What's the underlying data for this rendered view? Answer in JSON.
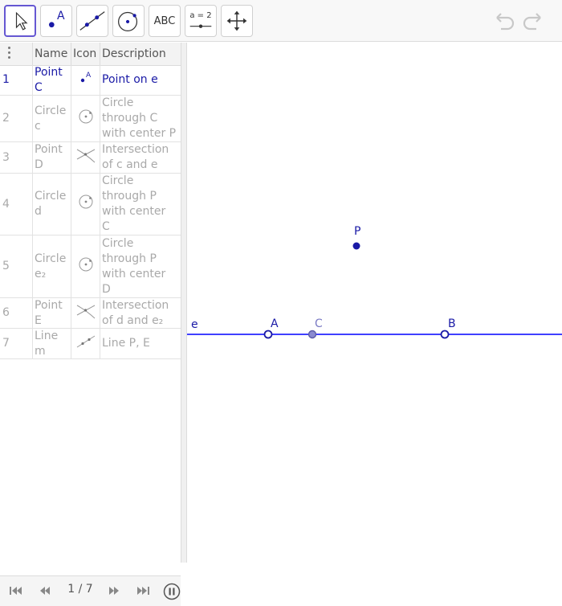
{
  "toolbar": {
    "tools": [
      {
        "name": "move-tool",
        "text": ""
      },
      {
        "name": "point-tool",
        "text": "A"
      },
      {
        "name": "line-tool",
        "text": ""
      },
      {
        "name": "circle-tool",
        "text": ""
      },
      {
        "name": "text-tool",
        "text": "ABC"
      },
      {
        "name": "slider-tool",
        "text": "a = 2"
      },
      {
        "name": "move-graphics-tool",
        "text": ""
      }
    ],
    "active_tool": "move-tool"
  },
  "construction_protocol": {
    "headers": {
      "name": "Name",
      "icon": "Icon",
      "description": "Description"
    },
    "rows": [
      {
        "num": "1",
        "name": [
          "Point",
          "C"
        ],
        "icon": "point-icon",
        "description": [
          "Point on e"
        ],
        "active": true
      },
      {
        "num": "2",
        "name": [
          "Circle",
          "c"
        ],
        "icon": "circle-icon",
        "description": [
          "Circle",
          "through C",
          "with center P"
        ],
        "active": false
      },
      {
        "num": "3",
        "name": [
          "Point",
          "D"
        ],
        "icon": "intersection-icon",
        "description": [
          "Intersection",
          "of c and e"
        ],
        "active": false
      },
      {
        "num": "4",
        "name": [
          "Circle",
          "d"
        ],
        "icon": "circle-icon",
        "description": [
          "Circle",
          "through P",
          "with center",
          "C"
        ],
        "active": false
      },
      {
        "num": "5",
        "name": [
          "Circle",
          "e₂"
        ],
        "icon": "circle-icon",
        "description": [
          "Circle",
          "through P",
          "with center",
          "D"
        ],
        "active": false
      },
      {
        "num": "6",
        "name": [
          "Point",
          "E"
        ],
        "icon": "intersection-icon",
        "description": [
          "Intersection",
          "of d and e₂"
        ],
        "active": false
      },
      {
        "num": "7",
        "name": [
          "Line",
          "m"
        ],
        "icon": "line-icon",
        "description": [
          "Line P, E"
        ],
        "active": false
      }
    ]
  },
  "navigation": {
    "counter": "1 / 7"
  },
  "graphics": {
    "line_label": "e",
    "points": [
      {
        "label": "P",
        "style": "filled"
      },
      {
        "label": "A",
        "style": "open"
      },
      {
        "label": "C",
        "style": "on-path"
      },
      {
        "label": "B",
        "style": "open"
      }
    ],
    "colors": {
      "object": "#1a1aa6",
      "line": "#0000ff",
      "point_on_path": "#6d6dbd"
    }
  }
}
